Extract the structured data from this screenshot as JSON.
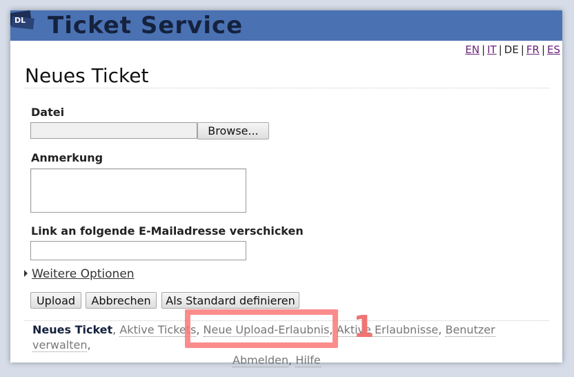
{
  "app": {
    "title": "Ticket Service",
    "logo": "ticket-logo-icon"
  },
  "languages": [
    {
      "code": "EN",
      "active": false
    },
    {
      "code": "IT",
      "active": false
    },
    {
      "code": "DE",
      "active": true
    },
    {
      "code": "FR",
      "active": false
    },
    {
      "code": "ES",
      "active": false
    }
  ],
  "lang_separator": "|",
  "page": {
    "title": "Neues Ticket"
  },
  "form": {
    "file_label": "Datei",
    "browse_label": "Browse...",
    "note_label": "Anmerkung",
    "note_value": "",
    "email_label": "Link an folgende E-Mailadresse verschicken",
    "email_value": "",
    "more_options_label": "Weitere Optionen",
    "buttons": {
      "upload": "Upload",
      "cancel": "Abbrechen",
      "set_default": "Als Standard definieren"
    }
  },
  "nav": {
    "current": "Neues Ticket",
    "items": [
      "Aktive Tickets",
      "Neue Upload-Erlaubnis",
      "Aktive Erlaubnisse",
      "Benutzer verwalten",
      "Abmelden",
      "Hilfe"
    ],
    "separator": ","
  },
  "annotation": {
    "number": "1",
    "color": "#f07474"
  },
  "colors": {
    "header": "#4a72b3",
    "title": "#15223e",
    "link_visited": "#6a1f7a"
  }
}
